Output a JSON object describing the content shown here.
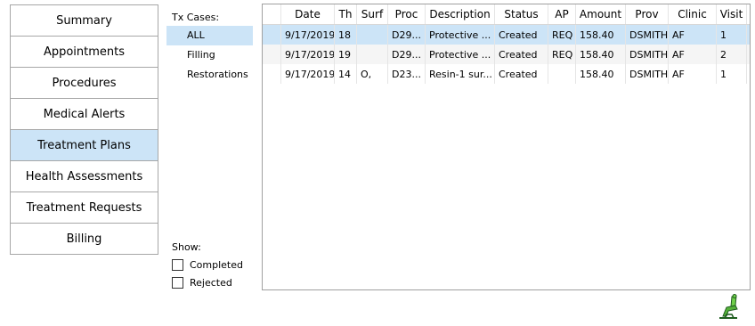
{
  "nav": {
    "items": [
      {
        "label": "Summary"
      },
      {
        "label": "Appointments"
      },
      {
        "label": "Procedures"
      },
      {
        "label": "Medical Alerts"
      },
      {
        "label": "Treatment Plans"
      },
      {
        "label": "Health Assessments"
      },
      {
        "label": "Treatment Requests"
      },
      {
        "label": "Billing"
      }
    ],
    "active": "Treatment Plans"
  },
  "tx_cases": {
    "label": "Tx Cases:",
    "items": [
      "ALL",
      "Filling",
      "Restorations"
    ],
    "selected": "ALL"
  },
  "show": {
    "label": "Show:",
    "completed": {
      "label": "Completed",
      "checked": false
    },
    "rejected": {
      "label": "Rejected",
      "checked": false
    }
  },
  "grid": {
    "columns": [
      "",
      "Date",
      "Th",
      "Surf",
      "Proc",
      "Description",
      "Status",
      "AP",
      "Amount",
      "Prov",
      "Clinic",
      "Visit"
    ],
    "rows": [
      [
        "",
        "9/17/2019",
        "18",
        "",
        "D29...",
        "Protective ...",
        "Created",
        "REQ",
        "158.40",
        "DSMITH",
        "AF",
        "1"
      ],
      [
        "",
        "9/17/2019",
        "19",
        "",
        "D29...",
        "Protective ...",
        "Created",
        "REQ",
        "158.40",
        "DSMITH",
        "AF",
        "2"
      ],
      [
        "",
        "9/17/2019",
        "14",
        "O,",
        "D23...",
        "Resin-1 sur...",
        "Created",
        "",
        "158.40",
        "DSMITH",
        "AF",
        "1"
      ]
    ]
  },
  "colors": {
    "selection": "#cce4f7",
    "border": "#a7a7a7"
  },
  "icons": {
    "bottom_right": "dental-chair-icon"
  }
}
